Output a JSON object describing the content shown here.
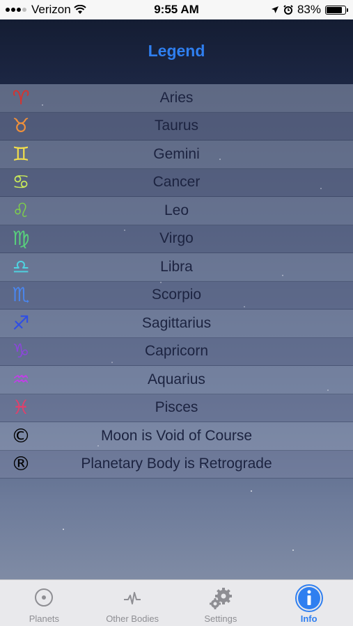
{
  "status_bar": {
    "carrier": "Verizon",
    "time": "9:55 AM",
    "battery_text": "83%",
    "battery_level": 0.83
  },
  "header": {
    "title": "Legend"
  },
  "legend": [
    {
      "glyph": "♈",
      "label": "Aries",
      "color": "#d8322e"
    },
    {
      "glyph": "♉",
      "label": "Taurus",
      "color": "#f0903a"
    },
    {
      "glyph": "♊",
      "label": "Gemini",
      "color": "#f4e04a"
    },
    {
      "glyph": "♋",
      "label": "Cancer",
      "color": "#c8e85a"
    },
    {
      "glyph": "♌",
      "label": "Leo",
      "color": "#7ed04a"
    },
    {
      "glyph": "♍",
      "label": "Virgo",
      "color": "#58cf7c"
    },
    {
      "glyph": "♎",
      "label": "Libra",
      "color": "#4fd2e0"
    },
    {
      "glyph": "♏",
      "label": "Scorpio",
      "color": "#4a86ee"
    },
    {
      "glyph": "♐",
      "label": "Sagittarius",
      "color": "#2f4ee6"
    },
    {
      "glyph": "♑",
      "label": "Capricorn",
      "color": "#8a48d8"
    },
    {
      "glyph": "♒",
      "label": "Aquarius",
      "color": "#c040e6"
    },
    {
      "glyph": "♓",
      "label": "Pisces",
      "color": "#e0406c"
    },
    {
      "glyph": "©",
      "label": "Moon is Void of Course",
      "color": "#000000"
    },
    {
      "glyph": "®",
      "label": "Planetary Body is Retrograde",
      "color": "#000000"
    }
  ],
  "tabbar": {
    "tabs": [
      {
        "label": "Planets",
        "icon": "planet-circle-icon",
        "active": false
      },
      {
        "label": "Other Bodies",
        "icon": "other-bodies-icon",
        "active": false
      },
      {
        "label": "Settings",
        "icon": "gear-icon",
        "active": false
      },
      {
        "label": "Info",
        "icon": "info-icon",
        "active": true
      }
    ]
  },
  "colors": {
    "accent": "#2f7ff0",
    "inactive": "#8e8e93"
  }
}
